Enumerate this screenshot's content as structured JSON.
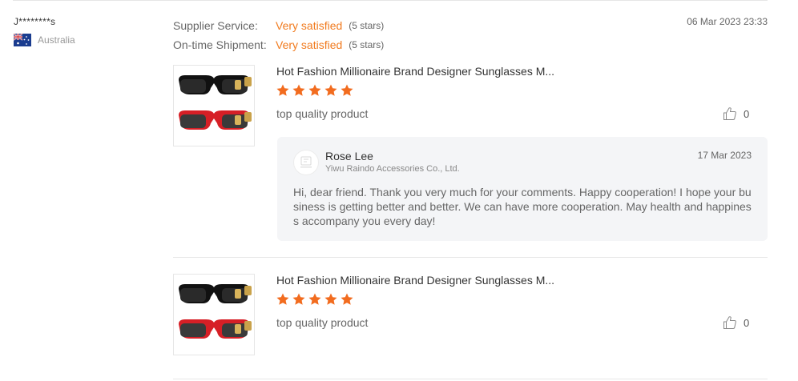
{
  "reviewer": {
    "name": "J********s",
    "country": "Australia",
    "flag_icon": "australia-flag-icon"
  },
  "ratings": [
    {
      "label": "Supplier Service:",
      "value": "Very satisfied",
      "stars_text": "(5 stars)"
    },
    {
      "label": "On-time Shipment:",
      "value": "Very satisfied",
      "stars_text": "(5 stars)"
    }
  ],
  "review_date": "06 Mar 2023 23:33",
  "products": [
    {
      "title": "Hot Fashion Millionaire Brand Designer Sunglasses M...",
      "rating": 5,
      "comment": "top quality product",
      "likes": "0",
      "image_icon": "sunglasses-product-icon"
    },
    {
      "title": "Hot Fashion Millionaire Brand Designer Sunglasses M...",
      "rating": 5,
      "comment": "top quality product",
      "likes": "0",
      "image_icon": "sunglasses-product-icon"
    }
  ],
  "reply": {
    "name": "Rose Lee",
    "company": "Yiwu Raindo Accessories Co., Ltd.",
    "date": "17 Mar 2023",
    "text": "Hi, dear friend. Thank you very much for your comments. Happy cooperation! I hope your business is getting better and better. We can have more cooperation. May health and happiness accompany you every day!"
  },
  "colors": {
    "accent": "#f17b1f",
    "star": "#f26c1f",
    "reply_bg": "#f4f5f7"
  }
}
